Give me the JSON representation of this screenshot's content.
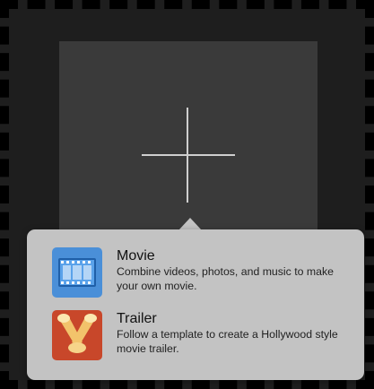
{
  "canvas": {
    "add_icon": "plus-icon"
  },
  "options": [
    {
      "title": "Movie",
      "description": "Combine videos, photos, and music to make your own movie.",
      "icon": "film-strip-icon",
      "icon_color": "#4a8fd8"
    },
    {
      "title": "Trailer",
      "description": "Follow a template to create a Hollywood style movie trailer.",
      "icon": "spotlights-icon",
      "icon_color": "#c8472a"
    }
  ]
}
